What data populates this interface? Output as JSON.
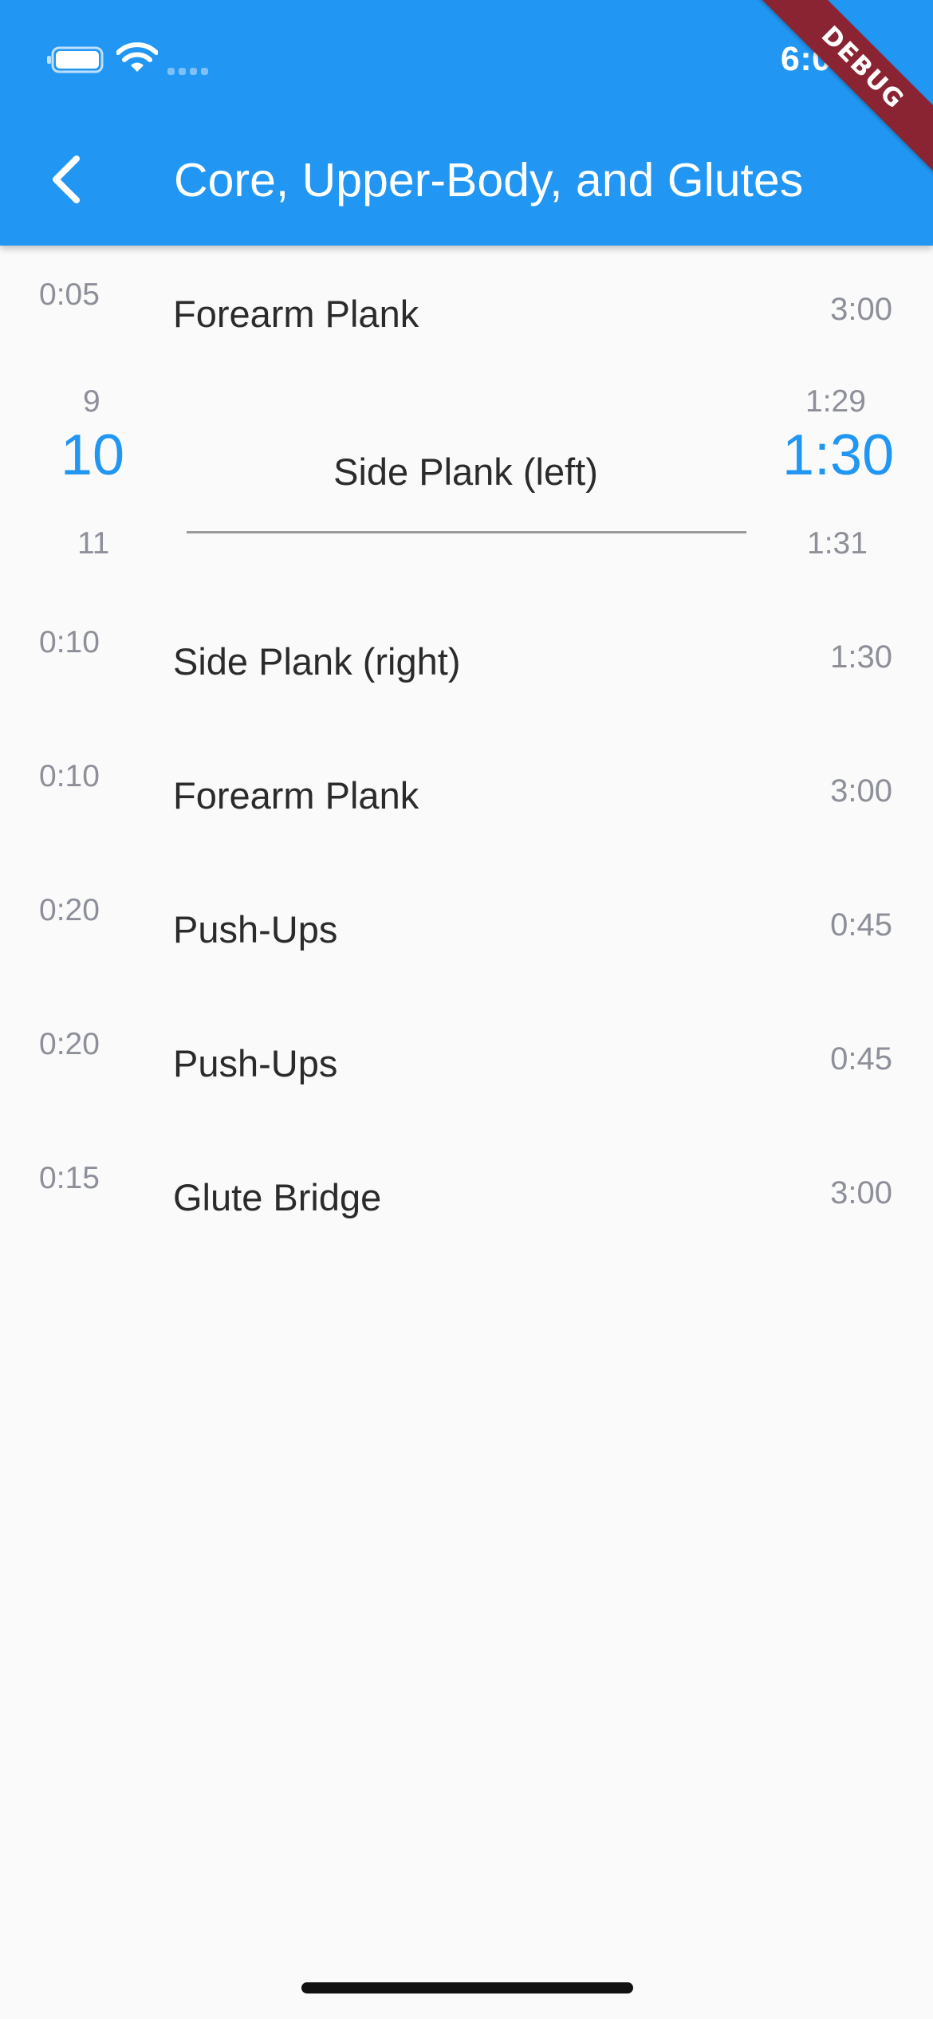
{
  "status_bar": {
    "time": "6:03",
    "icons": [
      "battery-icon",
      "wifi-icon",
      "signal-icon"
    ]
  },
  "debug_banner": "DEBUG",
  "app_bar": {
    "title": "Core, Upper-Body, and Glutes",
    "back_icon": "chevron-left-icon"
  },
  "colors": {
    "primary": "#2196f3",
    "muted_text": "#8d8f99",
    "debug_banner": "#8a2432"
  },
  "exercises": [
    {
      "rest": "0:05",
      "name": "Forearm Plank",
      "duration": "3:00"
    },
    {
      "selected": true,
      "name": "Side Plank (left)",
      "rest_picker": {
        "prev": "9",
        "current": "10",
        "next": "11"
      },
      "duration_picker": {
        "prev": "1:29",
        "current": "1:30",
        "next": "1:31"
      }
    },
    {
      "rest": "0:10",
      "name": "Side Plank (right)",
      "duration": "1:30"
    },
    {
      "rest": "0:10",
      "name": "Forearm Plank",
      "duration": "3:00"
    },
    {
      "rest": "0:20",
      "name": "Push-Ups",
      "duration": "0:45"
    },
    {
      "rest": "0:20",
      "name": "Push-Ups",
      "duration": "0:45"
    },
    {
      "rest": "0:15",
      "name": "Glute Bridge",
      "duration": "3:00"
    }
  ]
}
